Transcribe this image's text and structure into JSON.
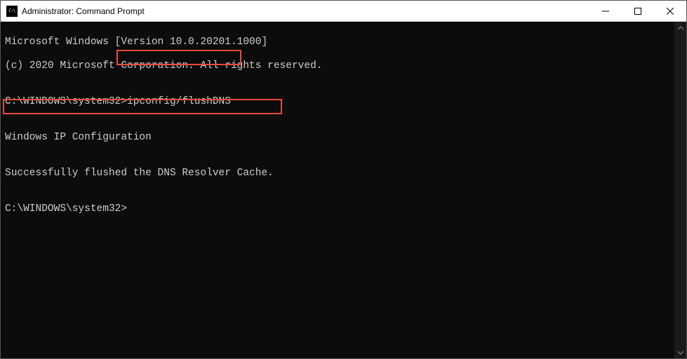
{
  "titlebar": {
    "icon_text": "C:\\",
    "title": "Administrator: Command Prompt"
  },
  "console": {
    "lines": {
      "l1": "Microsoft Windows [Version 10.0.20201.1000]",
      "l2": "(c) 2020 Microsoft Corporation. All rights reserved.",
      "l3": "",
      "l4a": "C:\\WINDOWS\\system32>",
      "l4b": "ipconfig/flushDNS",
      "l5": "",
      "l6": "Windows IP Configuration",
      "l7": "",
      "l8": "Successfully flushed the DNS Resolver Cache.",
      "l9": "",
      "l10": "C:\\WINDOWS\\system32>"
    }
  }
}
